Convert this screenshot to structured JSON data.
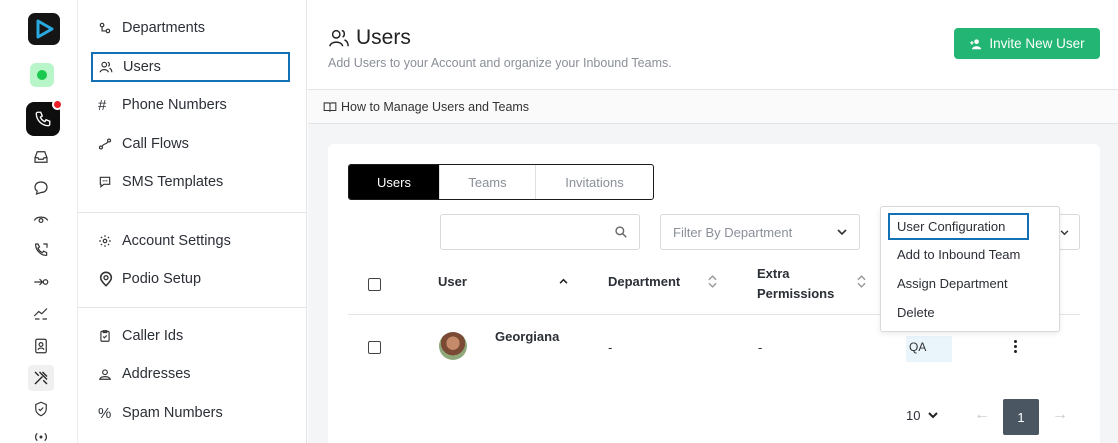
{
  "nav": {
    "items": [
      {
        "label": "Departments",
        "icon": "departments-icon"
      },
      {
        "label": "Users",
        "icon": "users-icon"
      },
      {
        "label": "Phone Numbers",
        "icon": "hash-icon"
      },
      {
        "label": "Call Flows",
        "icon": "call-flows-icon"
      },
      {
        "label": "SMS Templates",
        "icon": "sms-templates-icon"
      },
      {
        "label": "Account Settings",
        "icon": "gear-icon"
      },
      {
        "label": "Podio Setup",
        "icon": "podio-icon"
      },
      {
        "label": "Caller Ids",
        "icon": "caller-ids-icon"
      },
      {
        "label": "Addresses",
        "icon": "address-icon"
      },
      {
        "label": "Spam Numbers",
        "icon": "percent-icon"
      }
    ],
    "active": "Users"
  },
  "header": {
    "title": "Users",
    "subtitle": "Add Users to your Account and organize your Inbound Teams.",
    "invite_label": "Invite New User",
    "help_link": "How to Manage Users and Teams"
  },
  "tabs": [
    {
      "label": "Users",
      "active": true
    },
    {
      "label": "Teams",
      "active": false
    },
    {
      "label": "Invitations",
      "active": false
    }
  ],
  "filters": {
    "search_value": "",
    "department_placeholder": "Filter By Department"
  },
  "table": {
    "headers": [
      "User",
      "Department",
      "Extra",
      "Permissions"
    ],
    "rows": [
      {
        "name": "Georgiana",
        "department": "-",
        "extra_permissions": "-",
        "team": "QA"
      }
    ]
  },
  "menu": {
    "items": [
      "User Configuration",
      "Add to Inbound Team",
      "Assign Department",
      "Delete"
    ]
  },
  "pagination": {
    "page_size": "10",
    "current_page": "1",
    "prev": "←",
    "next": "→"
  },
  "colors": {
    "accent": "#22b573",
    "highlight": "#1470b5",
    "status": "#1cc94f",
    "badge": "#ee1c25"
  }
}
